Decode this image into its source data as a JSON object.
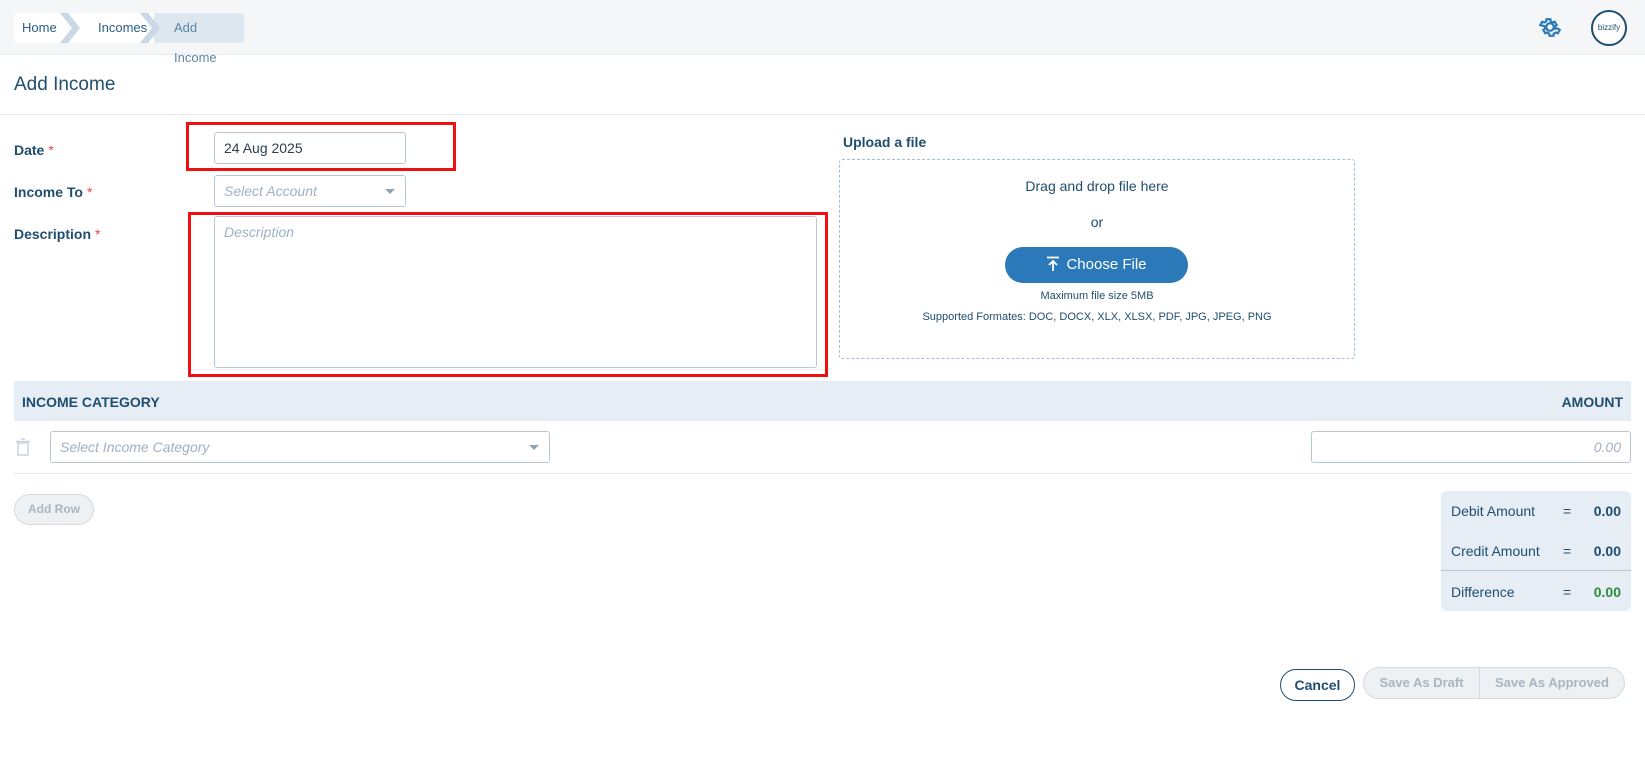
{
  "breadcrumb": [
    "Home",
    "Incomes",
    "Add Income"
  ],
  "header": {
    "settings_icon": "gear-icon",
    "avatar_text": "bizzify"
  },
  "page_title": "Add Income",
  "form": {
    "date_label": "Date",
    "date_value": "24 Aug 2025",
    "income_to_label": "Income To",
    "income_to_placeholder": "Select Account",
    "description_label": "Description",
    "description_placeholder": "Description",
    "required_mark": "*"
  },
  "upload": {
    "title": "Upload a file",
    "drag_text": "Drag and drop file here",
    "or_text": "or",
    "button_label": "Choose File",
    "max_size": "Maximum file size 5MB",
    "formats": "Supported Formates: DOC, DOCX, XLX, XLSX, PDF, JPG, JPEG, PNG"
  },
  "category_table": {
    "col_category": "INCOME CATEGORY",
    "col_amount": "AMOUNT",
    "category_placeholder": "Select Income Category",
    "amount_placeholder": "0.00"
  },
  "add_row_label": "Add Row",
  "summary": {
    "debit_label": "Debit Amount",
    "debit_value": "0.00",
    "credit_label": "Credit Amount",
    "credit_value": "0.00",
    "difference_label": "Difference",
    "difference_value": "0.00",
    "equals": "="
  },
  "actions": {
    "cancel": "Cancel",
    "save_draft": "Save As Draft",
    "save_approved": "Save As Approved"
  },
  "colors": {
    "accent": "#2b79b8",
    "text": "#1f4e6e",
    "highlight": "#ee1111",
    "positive": "#2e8b3d"
  }
}
